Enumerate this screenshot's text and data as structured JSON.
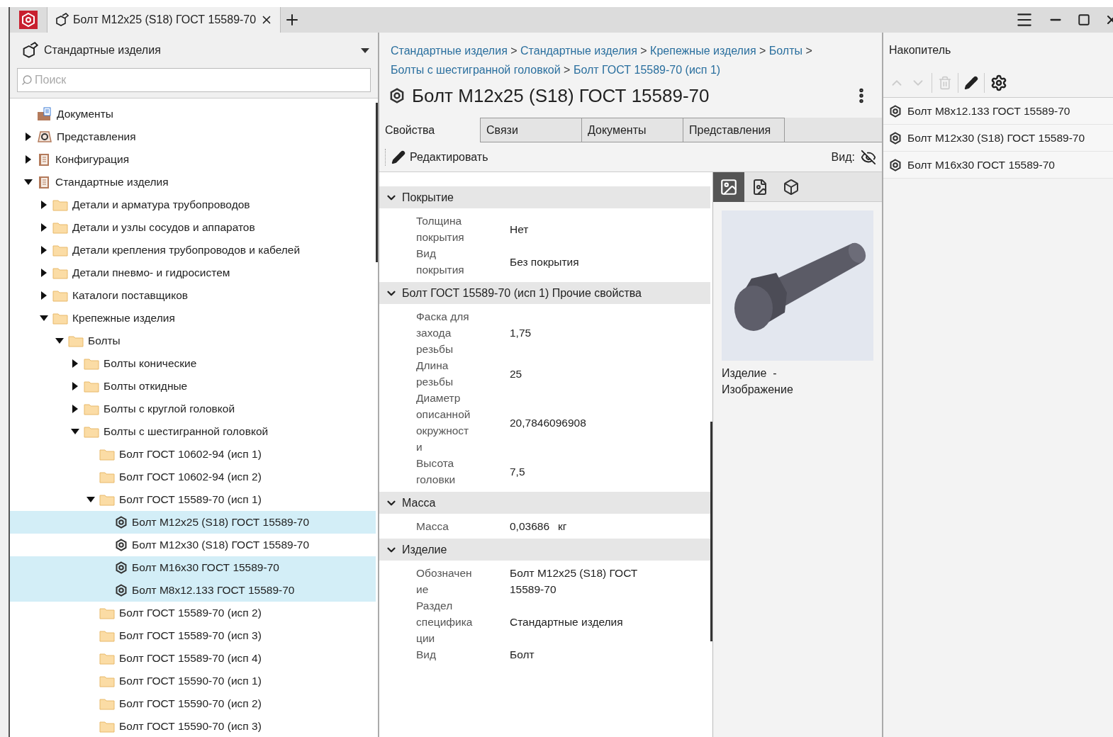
{
  "window": {
    "tab_title": "Болт М12x25 (S18) ГОСТ 15589-70"
  },
  "library": {
    "title": "Стандартные изделия",
    "search_placeholder": "Поиск"
  },
  "tree": [
    {
      "label": "Документы",
      "kind": "documents",
      "selected": false
    },
    {
      "label": "Представления",
      "kind": "representations",
      "expanded": false,
      "selected": false
    },
    {
      "label": "Конфигурация",
      "kind": "config",
      "expanded": false,
      "selected": false
    },
    {
      "label": "Стандартные изделия",
      "kind": "config",
      "expanded": true,
      "selected": false,
      "children": [
        {
          "label": "Детали и арматура трубопроводов",
          "kind": "folder",
          "expanded": false,
          "selected": false
        },
        {
          "label": "Детали и узлы сосудов и аппаратов",
          "kind": "folder",
          "expanded": false,
          "selected": false
        },
        {
          "label": "Детали крепления трубопроводов и кабелей",
          "kind": "folder",
          "expanded": false,
          "selected": false
        },
        {
          "label": "Детали пневмо- и гидросистем",
          "kind": "folder",
          "expanded": false,
          "selected": false
        },
        {
          "label": "Каталоги поставщиков",
          "kind": "folder",
          "expanded": false,
          "selected": false
        },
        {
          "label": "Крепежные изделия",
          "kind": "folder",
          "expanded": true,
          "selected": false,
          "children": [
            {
              "label": "Болты",
              "kind": "folder",
              "expanded": true,
              "selected": false,
              "children": [
                {
                  "label": "Болты конические",
                  "kind": "folder",
                  "expanded": false,
                  "selected": false
                },
                {
                  "label": "Болты откидные",
                  "kind": "folder",
                  "expanded": false,
                  "selected": false
                },
                {
                  "label": "Болты с круглой головкой",
                  "kind": "folder",
                  "expanded": false,
                  "selected": false
                },
                {
                  "label": "Болты с шестигранной головкой",
                  "kind": "folder",
                  "expanded": true,
                  "selected": false,
                  "children": [
                    {
                      "label": "Болт ГОСТ 10602-94 (исп 1)",
                      "kind": "folder",
                      "selected": false
                    },
                    {
                      "label": "Болт ГОСТ 10602-94 (исп 2)",
                      "kind": "folder",
                      "selected": false
                    },
                    {
                      "label": "Болт ГОСТ 15589-70 (исп 1)",
                      "kind": "folder",
                      "expanded": true,
                      "selected": false,
                      "children": [
                        {
                          "label": "Болт М12x25 (S18) ГОСТ 15589-70",
                          "kind": "part",
                          "selected": true
                        },
                        {
                          "label": "Болт М12x30 (S18) ГОСТ 15589-70",
                          "kind": "part",
                          "selected": false
                        },
                        {
                          "label": "Болт М16x30 ГОСТ 15589-70",
                          "kind": "part",
                          "selected": true
                        },
                        {
                          "label": "Болт М8x12.133 ГОСТ 15589-70",
                          "kind": "part",
                          "selected": true
                        }
                      ]
                    },
                    {
                      "label": "Болт ГОСТ 15589-70 (исп 2)",
                      "kind": "folder",
                      "selected": false
                    },
                    {
                      "label": "Болт ГОСТ 15589-70 (исп 3)",
                      "kind": "folder",
                      "selected": false
                    },
                    {
                      "label": "Болт ГОСТ 15589-70 (исп 4)",
                      "kind": "folder",
                      "selected": false
                    },
                    {
                      "label": "Болт ГОСТ 15590-70 (исп 1)",
                      "kind": "folder",
                      "selected": false
                    },
                    {
                      "label": "Болт ГОСТ 15590-70 (исп 2)",
                      "kind": "folder",
                      "selected": false
                    },
                    {
                      "label": "Болт ГОСТ 15590-70 (исп 3)",
                      "kind": "folder",
                      "selected": false
                    }
                  ]
                }
              ]
            }
          ]
        }
      ]
    }
  ],
  "breadcrumb": {
    "separator": ">",
    "items": [
      "Стандартные изделия",
      "Стандартные изделия",
      "Крепежные изделия",
      "Болты",
      "Болты с шестигранной головкой",
      "Болт ГОСТ 15589-70 (исп 1)"
    ]
  },
  "item_title": "Болт М12x25 (S18) ГОСТ 15589-70",
  "tabs": [
    {
      "label": "Свойства",
      "selected": true
    },
    {
      "label": "Связи",
      "selected": false
    },
    {
      "label": "Документы",
      "selected": false
    },
    {
      "label": "Представления",
      "selected": false
    }
  ],
  "toolbar": {
    "edit": "Редактировать",
    "view_label": "Вид:"
  },
  "property_groups": [
    {
      "title": "Покрытие",
      "expanded": true,
      "rows": [
        {
          "label": "Толщина покрытия",
          "value": "Нет"
        },
        {
          "label": "Вид покрытия",
          "value": "Без покрытия"
        }
      ]
    },
    {
      "title": "Болт ГОСТ 15589-70 (исп 1) Прочие свойства",
      "expanded": true,
      "rows": [
        {
          "label": "Фаска для захода резьбы",
          "value": "1,75"
        },
        {
          "label": "Длина резьбы",
          "value": "25"
        },
        {
          "label": "Диаметр описанной окружности",
          "value": "20,7846096908"
        },
        {
          "label": "Высота головки",
          "value": "7,5"
        }
      ]
    },
    {
      "title": "Масса",
      "expanded": true,
      "rows": [
        {
          "label": "Масса",
          "value": "0,03686",
          "unit": "кг"
        }
      ]
    },
    {
      "title": "Изделие",
      "expanded": true,
      "rows": [
        {
          "label": "Обозначение",
          "value": "Болт М12x25 (S18) ГОСТ 15589-70"
        },
        {
          "label": "Раздел спецификации",
          "value": "Стандартные изделия"
        },
        {
          "label": "Вид",
          "value": "Болт"
        }
      ]
    }
  ],
  "preview": {
    "views": [
      {
        "kind": "image",
        "selected": true
      },
      {
        "kind": "drawing",
        "selected": false
      },
      {
        "kind": "model",
        "selected": false
      }
    ],
    "caption": "Изделие  -  Изображение"
  },
  "storage": {
    "title": "Накопитель",
    "items": [
      "Болт М8x12.133 ГОСТ 15589-70",
      "Болт М12x30 (S18) ГОСТ 15589-70",
      "Болт М16x30 ГОСТ 15589-70"
    ]
  }
}
